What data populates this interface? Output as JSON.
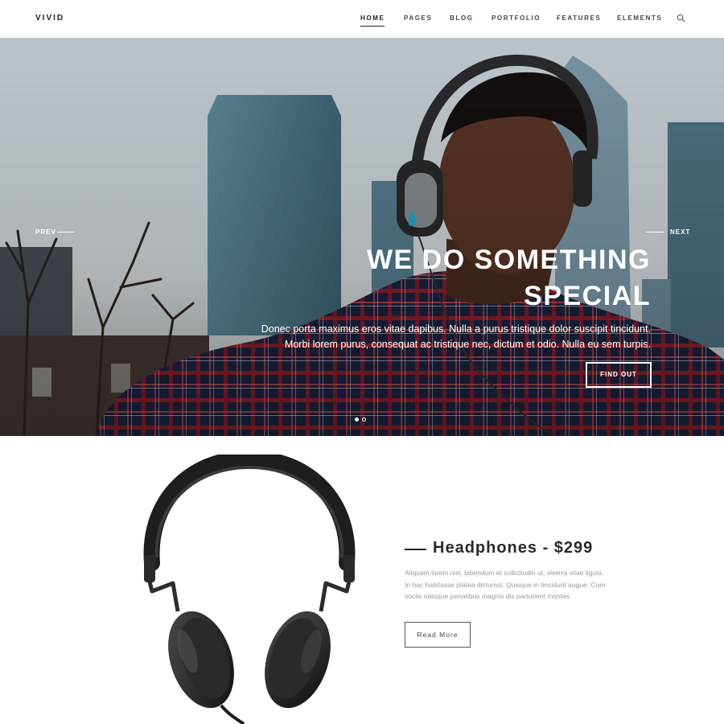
{
  "header": {
    "logo": "VIVID",
    "nav": [
      "HOME",
      "PAGES",
      "BLOG",
      "PORTFOLIO",
      "FEATURES",
      "ELEMENTS"
    ],
    "active_nav": "HOME",
    "search_icon": "search-icon"
  },
  "hero": {
    "prev_label": "PREV",
    "next_label": "NEXT",
    "title_line1": "WE DO SOMETHING",
    "title_line2": "SPECIAL",
    "text_line1": "Donec porta maximus eros vitae dapibus. Nulla a purus tristique dolor suscipit tincidunt.",
    "text_line2": "Morbi lorem purus, consequat ac tristique nec, dictum et odio. Nulla eu sem turpis.",
    "button_label": "FIND OUT",
    "slides_total": 2,
    "slide_active": 1
  },
  "product": {
    "title": "Headphones - $299",
    "description": "Aliquam lorem nisl, bibendum et sollicitudin ut, viverra vitae ligula. In hac habitasse platea dictumst. Quisque in tincidunt augue. Cum sociis natoque penatibus magnis dis parturient montes.",
    "button_label": "Read More"
  },
  "colors": {
    "text_dark": "#222222",
    "hero_text": "#ffffff",
    "muted_text": "#999999"
  }
}
